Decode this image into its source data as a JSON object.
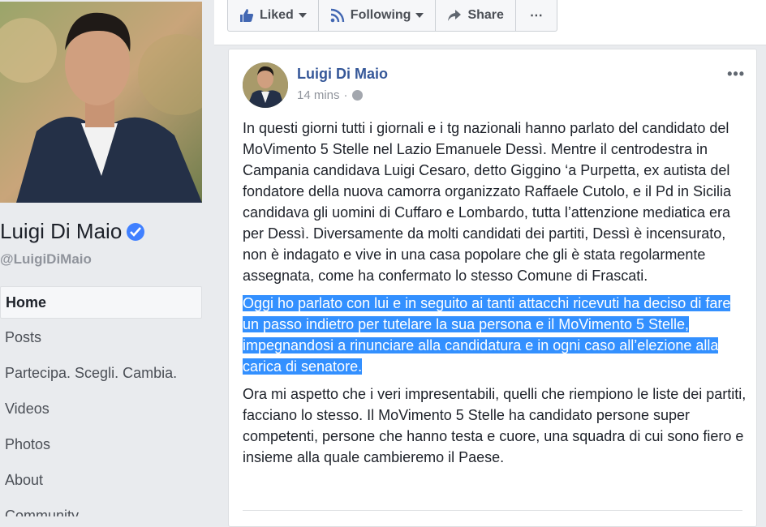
{
  "page": {
    "name": "Luigi Di Maio",
    "handle": "@LuigiDiMaio"
  },
  "nav": {
    "items": [
      {
        "label": "Home"
      },
      {
        "label": "Posts"
      },
      {
        "label": "Partecipa. Scegli. Cambia."
      },
      {
        "label": "Videos"
      },
      {
        "label": "Photos"
      },
      {
        "label": "About"
      },
      {
        "label": "Community"
      }
    ]
  },
  "actionbar": {
    "liked": "Liked",
    "following": "Following",
    "share": "Share",
    "more": "⋯"
  },
  "post": {
    "author": "Luigi Di Maio",
    "time": "14 mins",
    "separator": "·",
    "menu": "•••",
    "paragraphs": [
      "In questi giorni tutti i giornali e i tg nazionali hanno parlato del candidato del MoVimento 5 Stelle nel Lazio Emanuele Dessì. Mentre il centrodestra in Campania candidava Luigi Cesaro, detto Giggino ‘a Purpetta, ex autista del fondatore della nuova camorra organizzato Raffaele Cutolo, e il Pd in Sicilia candidava gli uomini di Cuffaro e Lombardo, tutta l’attenzione mediatica era per Dessì. Diversamente da molti candidati dei partiti, Dessì è incensurato, non è indagato e vive in una casa popolare che gli è stata regolarmente assegnata, come ha confermato lo stesso Comune di Frascati.",
      "Oggi ho parlato con lui e in seguito ai tanti attacchi ricevuti ha deciso di fare un passo indietro per tutelare la sua persona e il MoVimento 5 Stelle, impegnandosi a rinunciare alla candidatura e in ogni caso all’elezione alla carica di senatore.",
      "Ora mi aspetto che i veri impresentabili, quelli che riempiono le liste dei partiti, facciano lo stesso. Il MoVimento 5 Stelle ha candidato persone super competenti, persone che hanno testa e cuore, una squadra di cui sono fiero e insieme alla quale cambieremo il Paese."
    ]
  },
  "icons": {
    "like": "thumbs-up-icon",
    "following": "rss-icon",
    "share": "share-arrow-icon",
    "verified": "verified-check-icon",
    "privacy": "globe-icon"
  },
  "colors": {
    "link": "#365899",
    "verified": "#4080ff",
    "selection": "#3390ff",
    "background": "#e9ebee"
  }
}
